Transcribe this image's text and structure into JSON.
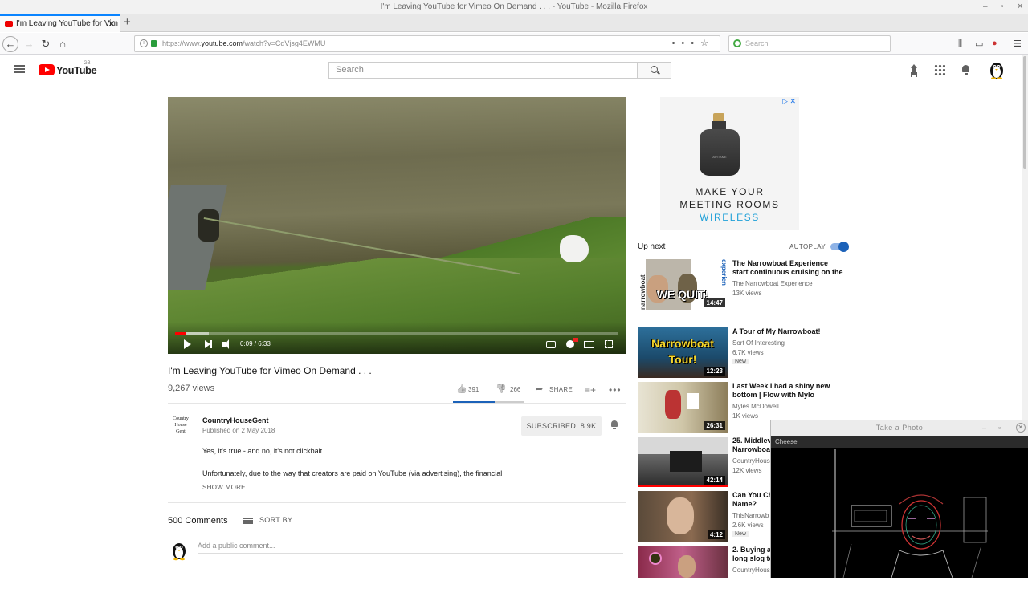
{
  "browser": {
    "window_title": "I'm Leaving YouTube for Vimeo On Demand . . . - YouTube - Mozilla Firefox",
    "tab_title": "I'm Leaving YouTube for Vim",
    "url_prefix": "https://www.",
    "url_host": "youtube.com",
    "url_path": "/watch?v=CdVjsg4EWMU",
    "search_placeholder": "Search",
    "accent_color": "#0a84ff"
  },
  "youtube": {
    "logo_text": "YouTube",
    "country_code": "GB",
    "search_placeholder": "Search",
    "brand_color": "#ff0000"
  },
  "player": {
    "time_display": "0:09 / 6:33",
    "progress_fraction": 0.023
  },
  "video": {
    "title": "I'm Leaving YouTube for Vimeo On Demand . . .",
    "views": "9,267 views",
    "likes": "391",
    "dislikes": "266",
    "share_label": "SHARE",
    "like_fraction": 0.595
  },
  "channel": {
    "avatar_text_1": "Country",
    "avatar_text_2": "House",
    "avatar_text_3": "Gent",
    "name": "CountryHouseGent",
    "published": "Published on 2 May 2018",
    "subscribe_label": "SUBSCRIBED",
    "subscriber_count": "8.9K",
    "description_line1": "Yes, it's true - and no, it's not clickbait.",
    "description_line2": "Unfortunately, due to the way that creators are paid on YouTube (via advertising), the financial",
    "show_more_label": "SHOW MORE"
  },
  "comments": {
    "count_label": "500 Comments",
    "sort_label": "SORT BY",
    "input_placeholder": "Add a public comment..."
  },
  "ad": {
    "device_label": "AIRTAME",
    "line1": "MAKE YOUR",
    "line2": "MEETING ROOMS",
    "line3": "WIRELESS"
  },
  "sidebar": {
    "up_next_label": "Up next",
    "autoplay_label": "AUTOPLAY",
    "recommendations": [
      {
        "title_1": "The Narrowboat Experience",
        "title_2": "start continuous cruising on the",
        "channel": "The Narrowboat Experience",
        "views": "13K views",
        "duration": "14:47",
        "thumb_text": "WE QUIT!",
        "side_text": "experien",
        "side_text_2": "narrowboat"
      },
      {
        "title_1": "A Tour of My Narrowboat!",
        "title_2": "",
        "channel": "Sort Of Interesting",
        "views": "6.7K views",
        "badge": "New",
        "duration": "12:23",
        "thumb_text_1": "Narrowboat",
        "thumb_text_2": "Tour!"
      },
      {
        "title_1": "Last Week I had a shiny new",
        "title_2": "bottom | Flow with Mylo",
        "channel": "Myles McDowell",
        "views": "1K views",
        "duration": "26:31"
      },
      {
        "title_1": "25. Middlev",
        "title_2": "Narrowboa",
        "channel": "CountryHous",
        "views": "12K views",
        "duration": "42:14"
      },
      {
        "title_1": "Can You Ch",
        "title_2": "Name?",
        "channel": "ThisNarrowb",
        "views": "2.6K views",
        "badge": "New",
        "duration": "4:12"
      },
      {
        "title_1": "2. Buying a",
        "title_2": "long slog to",
        "channel": "CountryHous",
        "views": "",
        "duration": ""
      }
    ]
  },
  "cheese": {
    "title": "Take a Photo",
    "menu_label": "Cheese"
  }
}
